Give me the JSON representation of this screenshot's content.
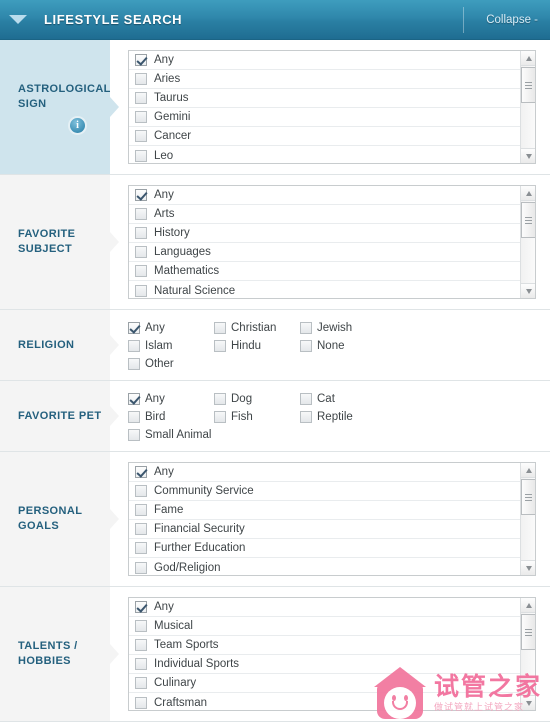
{
  "header": {
    "title": "LIFESTYLE SEARCH",
    "collapse_label": "Collapse -",
    "toggle_icon": "triangle-down-icon",
    "accent_color": "#2f87ab"
  },
  "sections": [
    {
      "id": "astrological-sign",
      "label_line1": "ASTROLOGICAL",
      "label_line2": "SIGN",
      "has_info_icon": true,
      "info_icon": "info-circle-icon",
      "type": "scroll-list",
      "options": [
        {
          "label": "Any",
          "checked": true
        },
        {
          "label": "Aries",
          "checked": false
        },
        {
          "label": "Taurus",
          "checked": false
        },
        {
          "label": "Gemini",
          "checked": false
        },
        {
          "label": "Cancer",
          "checked": false
        },
        {
          "label": "Leo",
          "checked": false
        }
      ]
    },
    {
      "id": "favorite-subject",
      "label_line1": "FAVORITE",
      "label_line2": "SUBJECT",
      "has_info_icon": false,
      "type": "scroll-list",
      "options": [
        {
          "label": "Any",
          "checked": true
        },
        {
          "label": "Arts",
          "checked": false
        },
        {
          "label": "History",
          "checked": false
        },
        {
          "label": "Languages",
          "checked": false
        },
        {
          "label": "Mathematics",
          "checked": false
        },
        {
          "label": "Natural Science",
          "checked": false
        }
      ]
    },
    {
      "id": "religion",
      "label_line1": "RELIGION",
      "label_line2": "",
      "has_info_icon": false,
      "type": "grid",
      "options": [
        {
          "label": "Any",
          "checked": true
        },
        {
          "label": "Christian",
          "checked": false
        },
        {
          "label": "Jewish",
          "checked": false
        },
        {
          "label": "Islam",
          "checked": false
        },
        {
          "label": "Hindu",
          "checked": false
        },
        {
          "label": "None",
          "checked": false
        },
        {
          "label": "Other",
          "checked": false
        }
      ]
    },
    {
      "id": "favorite-pet",
      "label_line1": "FAVORITE PET",
      "label_line2": "",
      "has_info_icon": false,
      "type": "grid",
      "options": [
        {
          "label": "Any",
          "checked": true
        },
        {
          "label": "Dog",
          "checked": false
        },
        {
          "label": "Cat",
          "checked": false
        },
        {
          "label": "Bird",
          "checked": false
        },
        {
          "label": "Fish",
          "checked": false
        },
        {
          "label": "Reptile",
          "checked": false
        },
        {
          "label": "Small Animal",
          "checked": false
        }
      ]
    },
    {
      "id": "personal-goals",
      "label_line1": "PERSONAL",
      "label_line2": "GOALS",
      "has_info_icon": false,
      "type": "scroll-list",
      "options": [
        {
          "label": "Any",
          "checked": true
        },
        {
          "label": "Community Service",
          "checked": false
        },
        {
          "label": "Fame",
          "checked": false
        },
        {
          "label": "Financial Security",
          "checked": false
        },
        {
          "label": "Further Education",
          "checked": false
        },
        {
          "label": "God/Religion",
          "checked": false
        }
      ]
    },
    {
      "id": "talents-hobbies",
      "label_line1": "TALENTS /",
      "label_line2": "HOBBIES",
      "has_info_icon": false,
      "type": "scroll-list",
      "options": [
        {
          "label": "Any",
          "checked": true
        },
        {
          "label": "Musical",
          "checked": false
        },
        {
          "label": "Team Sports",
          "checked": false
        },
        {
          "label": "Individual Sports",
          "checked": false
        },
        {
          "label": "Culinary",
          "checked": false
        },
        {
          "label": "Craftsman",
          "checked": false
        }
      ]
    }
  ],
  "watermark": {
    "title": "试管之家",
    "subtitle": "做试管就上试管之家",
    "logo_icon": "house-smiley-logo-icon",
    "color": "#f2709c"
  }
}
